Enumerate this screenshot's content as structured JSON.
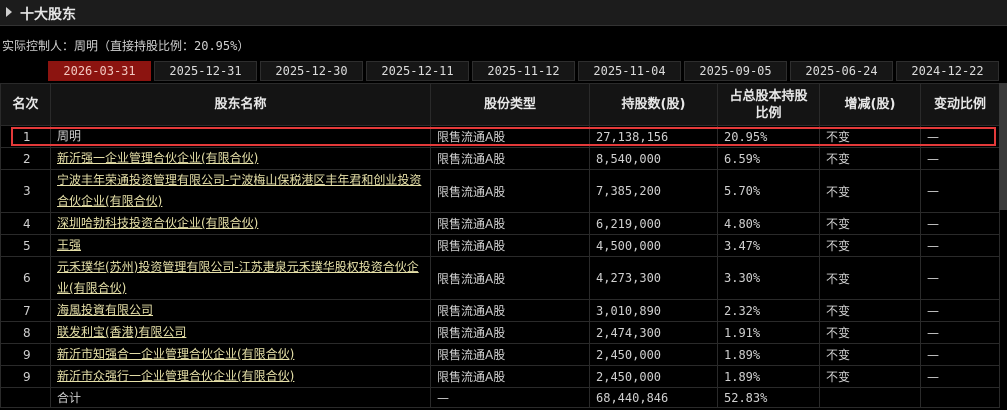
{
  "section": {
    "title": "十大股东"
  },
  "controller_text": "实际控制人：周明（直接持股比例：20.95%）",
  "tabs": [
    {
      "label": "2026-03-31",
      "active": true
    },
    {
      "label": "2025-12-31"
    },
    {
      "label": "2025-12-30"
    },
    {
      "label": "2025-12-11"
    },
    {
      "label": "2025-11-12"
    },
    {
      "label": "2025-11-04"
    },
    {
      "label": "2025-09-05"
    },
    {
      "label": "2025-06-24"
    },
    {
      "label": "2024-12-22"
    }
  ],
  "columns": {
    "rank": "名次",
    "name": "股东名称",
    "type": "股份类型",
    "shares": "持股数(股)",
    "ratio": "占总股本持股比例",
    "change": "增减(股)",
    "change_ratio": "变动比例"
  },
  "rows": [
    {
      "rank": "1",
      "name": "周明",
      "type": "限售流通A股",
      "shares": "27,138,156",
      "ratio": "20.95%",
      "change": "不变",
      "change_ratio": "—"
    },
    {
      "rank": "2",
      "name": "新沂强一企业管理合伙企业(有限合伙)",
      "type": "限售流通A股",
      "shares": "8,540,000",
      "ratio": "6.59%",
      "change": "不变",
      "change_ratio": "—"
    },
    {
      "rank": "3",
      "name": "宁波丰年荣通投资管理有限公司-宁波梅山保税港区丰年君和创业投资合伙企业(有限合伙)",
      "type": "限售流通A股",
      "shares": "7,385,200",
      "ratio": "5.70%",
      "change": "不变",
      "change_ratio": "—"
    },
    {
      "rank": "4",
      "name": "深圳哈勃科技投资合伙企业(有限合伙)",
      "type": "限售流通A股",
      "shares": "6,219,000",
      "ratio": "4.80%",
      "change": "不变",
      "change_ratio": "—"
    },
    {
      "rank": "5",
      "name": "王强",
      "type": "限售流通A股",
      "shares": "4,500,000",
      "ratio": "3.47%",
      "change": "不变",
      "change_ratio": "—"
    },
    {
      "rank": "6",
      "name": "元禾璞华(苏州)投资管理有限公司-江苏疌泉元禾璞华股权投资合伙企业(有限合伙)",
      "type": "限售流通A股",
      "shares": "4,273,300",
      "ratio": "3.30%",
      "change": "不变",
      "change_ratio": "—"
    },
    {
      "rank": "7",
      "name": "海風投資有限公司",
      "type": "限售流通A股",
      "shares": "3,010,890",
      "ratio": "2.32%",
      "change": "不变",
      "change_ratio": "—"
    },
    {
      "rank": "8",
      "name": "联发利宝(香港)有限公司",
      "type": "限售流通A股",
      "shares": "2,474,300",
      "ratio": "1.91%",
      "change": "不变",
      "change_ratio": "—"
    },
    {
      "rank": "9",
      "name": "新沂市知强合一企业管理合伙企业(有限合伙)",
      "type": "限售流通A股",
      "shares": "2,450,000",
      "ratio": "1.89%",
      "change": "不变",
      "change_ratio": "—"
    },
    {
      "rank": "9",
      "name": "新沂市众强行一企业管理合伙企业(有限合伙)",
      "type": "限售流通A股",
      "shares": "2,450,000",
      "ratio": "1.89%",
      "change": "不变",
      "change_ratio": "—"
    }
  ],
  "total": {
    "label": "合计",
    "type": "—",
    "shares": "68,440,846",
    "ratio": "52.83%"
  }
}
